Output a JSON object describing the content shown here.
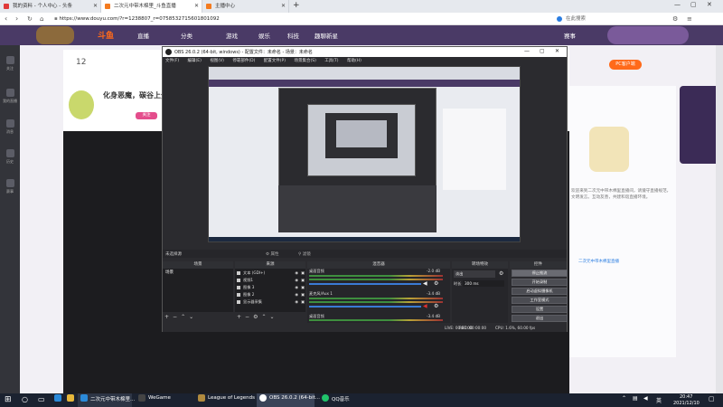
{
  "browser": {
    "tabs": [
      {
        "label": "我的资料 - 个人中心 - 头条"
      },
      {
        "label": "二次元中带木棉里_斗鱼直播"
      },
      {
        "label": "主播中心"
      }
    ],
    "new_tab": "+",
    "url": "https://www.douyu.com/?r=1238807_r=0758532715601801092",
    "search_placeholder": "在此搜索",
    "colors": {
      "accent": "#1b8fe9",
      "tabbar": "#e6e9ee"
    }
  },
  "site": {
    "logo": "斗鱼",
    "nav": [
      "直播",
      "分类",
      "游戏",
      "娱乐",
      "科技",
      "赛事",
      "趣聊新星"
    ],
    "side_items": [
      "关注",
      "我的直播",
      "消息",
      "历史",
      "赛事"
    ],
    "level": "12",
    "streamer_name": "化身恶魔，碳谷上分",
    "follow_btn": "关注",
    "right_btn": "PC客户端",
    "bottom_text": "二次元中带木棉里直播",
    "chat_snippet": "欢迎来到二次元中带木棉里直播间，请遵守直播规范，文明发言。互动友善，共建和谐直播环境。"
  },
  "obs": {
    "title": "OBS 26.0.2 (64-bit, windows) - 配置文件：未命名 - 场景：未命名",
    "menu": [
      "文件(F)",
      "编辑(E)",
      "视图(V)",
      "停靠部件(D)",
      "配置文件(P)",
      "场景集合(S)",
      "工具(T)",
      "帮助(H)"
    ],
    "no_source": "未选择源",
    "properties": "属性",
    "filters": "滤镜",
    "panels": {
      "scenes": "场景",
      "sources": "来源",
      "mixer": "混音器",
      "transitions": "转场特效",
      "controls": "控件"
    },
    "scene_list": [
      "场景"
    ],
    "sources": [
      {
        "name": "文本 (GDI+)"
      },
      {
        "name": "视频1"
      },
      {
        "name": "图像 3"
      },
      {
        "name": "图像 2"
      },
      {
        "name": "显示器采集"
      }
    ],
    "mixer": [
      {
        "name": "桌面音频",
        "db": "-2.0 dB"
      },
      {
        "name": "麦克风/Aux 1",
        "db": "-3.4 dB"
      },
      {
        "name": "桌面音频",
        "db": "-3.4 dB"
      }
    ],
    "transition": {
      "type": "淡出",
      "duration_label": "时长",
      "duration": "300 ms"
    },
    "controls": [
      "停止推流",
      "开始录制",
      "启动虚拟摄像机",
      "工作室模式",
      "设置",
      "退出"
    ],
    "status": {
      "live": "LIVE: 00:00:00",
      "rec": "REC: 00:00:00",
      "cpu": "CPU: 1.6%, 60.00 fps"
    }
  },
  "taskbar": {
    "search_icon": "search-icon",
    "apps": [
      {
        "label": "二次元中带木棉里..."
      },
      {
        "label": "WeGame"
      },
      {
        "label": "League of Legends"
      },
      {
        "label": "OBS 26.0.2 (64-bit..."
      },
      {
        "label": "QQ音乐"
      }
    ],
    "time": "20:47",
    "date": "2021/12/10",
    "lang": "英"
  }
}
